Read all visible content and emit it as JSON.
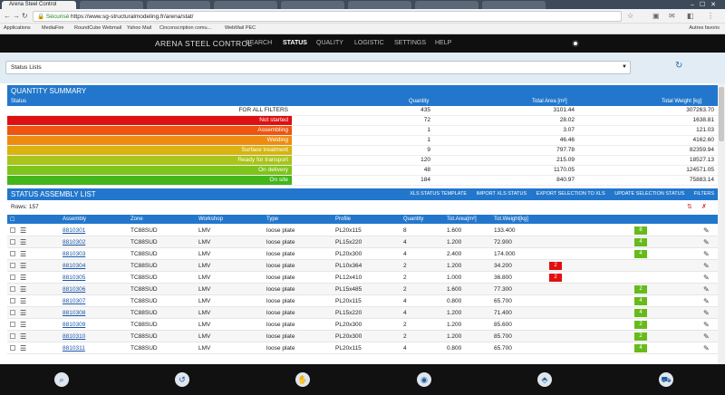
{
  "browser": {
    "tab_title": "Arena Steel Control",
    "url_secure": "Sécurisé",
    "url": "https://www.sg-structuralmodeling.fr/arena/stat/",
    "bookmarks": [
      "Applications",
      "MediaFire",
      "RoundCube Webmail",
      "Yahoo Mail",
      "Cinconscription comu...",
      "WebMail PEC"
    ],
    "bookmarks_right": "Autres favoris"
  },
  "app": {
    "brand": "ARENA STEEL CONTROL",
    "menu": [
      "SEARCH",
      "STATUS",
      "QUALITY",
      "LOGISTIC",
      "SETTINGS",
      "HELP"
    ],
    "active_menu": "STATUS"
  },
  "status_select": {
    "value": "Status Lists"
  },
  "quantity_summary": {
    "title": "QUANTITY SUMMARY",
    "columns": [
      "Status",
      "Quantity",
      "Total Area [m²]",
      "Total Weight [kg]"
    ],
    "rows": [
      {
        "status": "FOR ALL FILTERS",
        "quantity": "435",
        "area": "3101.44",
        "weight": "307263.70",
        "color": "#ffffff"
      },
      {
        "status": "Not started",
        "quantity": "72",
        "area": "28.02",
        "weight": "1638.81",
        "color": "#dd1111"
      },
      {
        "status": "Assembling",
        "quantity": "1",
        "area": "3.07",
        "weight": "121.03",
        "color": "#ee5511"
      },
      {
        "status": "Welding",
        "quantity": "1",
        "area": "46.46",
        "weight": "4162.60",
        "color": "#ee8c11"
      },
      {
        "status": "Surface treatment",
        "quantity": "9",
        "area": "797.78",
        "weight": "82359.94",
        "color": "#d9b310"
      },
      {
        "status": "Ready for transport",
        "quantity": "120",
        "area": "215.09",
        "weight": "18527.13",
        "color": "#a9c41a"
      },
      {
        "status": "On delivery",
        "quantity": "48",
        "area": "1170.05",
        "weight": "124571.05",
        "color": "#7fc41a"
      },
      {
        "status": "On site",
        "quantity": "184",
        "area": "840.97",
        "weight": "75883.14",
        "color": "#44b51a"
      }
    ]
  },
  "status_assembly_list": {
    "title": "STATUS ASSEMBLY LIST",
    "actions": [
      "XLS STATUS TEMPLATE",
      "IMPORT XLS STATUS",
      "EXPORT SELECTION TO XLS",
      "UPDATE SELECTION STATUS",
      "FILTERS"
    ],
    "rows_label": "Rows: 157",
    "columns": [
      "Assembly",
      "Zone",
      "Workshop",
      "Type",
      "Profile",
      "Quantity",
      "Tot.Area[m²]",
      "Tot.Weight[kg]"
    ],
    "rows": [
      {
        "assembly": "8810301",
        "zone": "TC88SUD",
        "workshop": "LMV",
        "type": "loose plate",
        "profile": "PL20x115",
        "quantity": "8",
        "area": "1.600",
        "weight": "133.400",
        "red": "",
        "green": "8"
      },
      {
        "assembly": "8810302",
        "zone": "TC88SUD",
        "workshop": "LMV",
        "type": "loose plate",
        "profile": "PL15x220",
        "quantity": "4",
        "area": "1.200",
        "weight": "72.900",
        "red": "",
        "green": "4"
      },
      {
        "assembly": "8810303",
        "zone": "TC88SUD",
        "workshop": "LMV",
        "type": "loose plate",
        "profile": "PL20x300",
        "quantity": "4",
        "area": "2.400",
        "weight": "174.000",
        "red": "",
        "green": "4"
      },
      {
        "assembly": "8810304",
        "zone": "TC88SUD",
        "workshop": "LMV",
        "type": "loose plate",
        "profile": "PL10x364",
        "quantity": "2",
        "area": "1.200",
        "weight": "34.200",
        "red": "2",
        "green": ""
      },
      {
        "assembly": "8810305",
        "zone": "TC88SUD",
        "workshop": "LMV",
        "type": "loose plate",
        "profile": "PL12x410",
        "quantity": "2",
        "area": "1.000",
        "weight": "36.800",
        "red": "2",
        "green": ""
      },
      {
        "assembly": "8810306",
        "zone": "TC88SUD",
        "workshop": "LMV",
        "type": "loose plate",
        "profile": "PL15x485",
        "quantity": "2",
        "area": "1.600",
        "weight": "77.300",
        "red": "",
        "green": "2"
      },
      {
        "assembly": "8810307",
        "zone": "TC88SUD",
        "workshop": "LMV",
        "type": "loose plate",
        "profile": "PL20x115",
        "quantity": "4",
        "area": "0.800",
        "weight": "65.700",
        "red": "",
        "green": "4"
      },
      {
        "assembly": "8810308",
        "zone": "TC88SUD",
        "workshop": "LMV",
        "type": "loose plate",
        "profile": "PL15x220",
        "quantity": "4",
        "area": "1.200",
        "weight": "71.400",
        "red": "",
        "green": "4"
      },
      {
        "assembly": "8810309",
        "zone": "TC88SUD",
        "workshop": "LMV",
        "type": "loose plate",
        "profile": "PL20x300",
        "quantity": "2",
        "area": "1.200",
        "weight": "85.600",
        "red": "",
        "green": "2"
      },
      {
        "assembly": "8810310",
        "zone": "TC88SUD",
        "workshop": "LMV",
        "type": "loose plate",
        "profile": "PL20x300",
        "quantity": "2",
        "area": "1.200",
        "weight": "85.700",
        "red": "",
        "green": "2"
      },
      {
        "assembly": "8810311",
        "zone": "TC88SUD",
        "workshop": "LMV",
        "type": "loose plate",
        "profile": "PL20x115",
        "quantity": "4",
        "area": "0.800",
        "weight": "65.700",
        "red": "",
        "green": "4"
      }
    ]
  },
  "bottom_toolbar": [
    "search-icon",
    "history-icon",
    "hand-icon",
    "eye-icon",
    "tag-icon",
    "truck-icon"
  ]
}
